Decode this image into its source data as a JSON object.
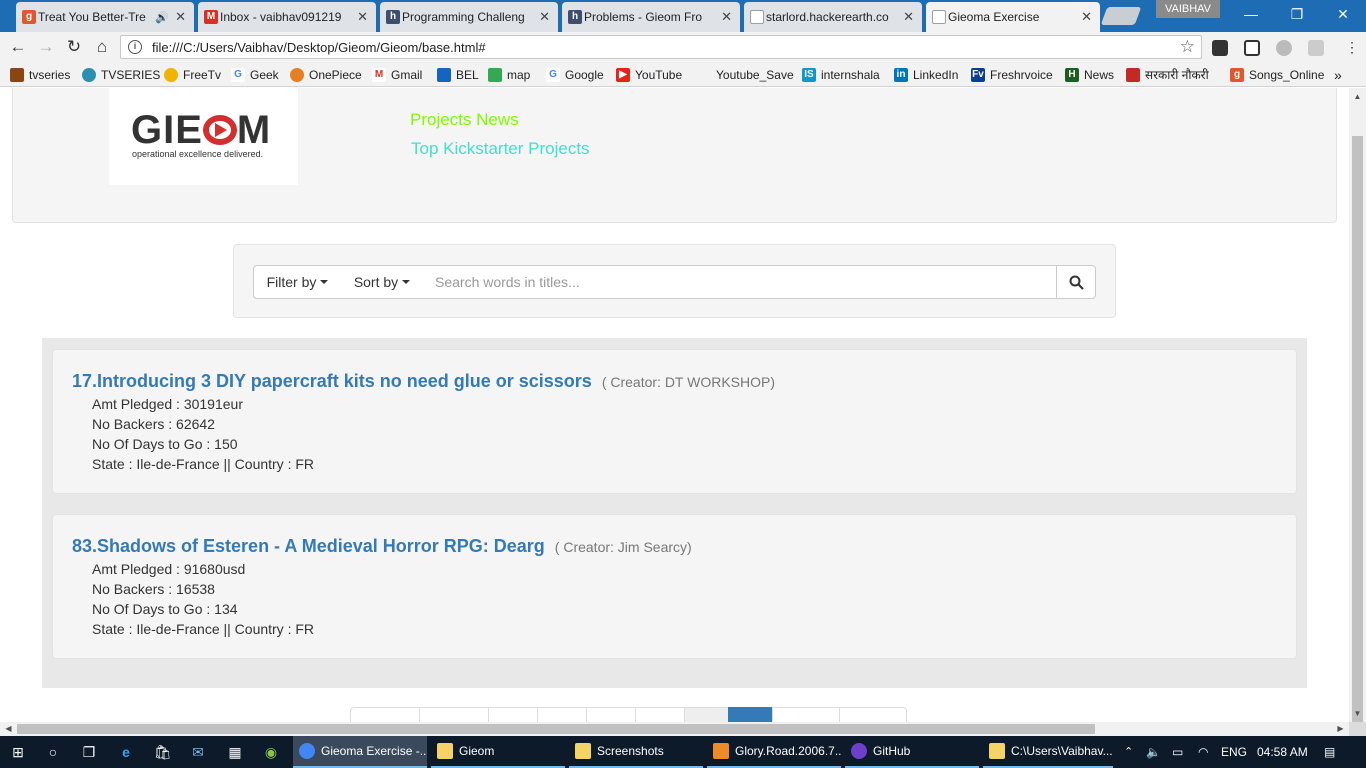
{
  "browser": {
    "tabs": [
      {
        "title": "Treat You Better-Tre",
        "favicon_color": "#e4572e",
        "favicon_glyph": "g",
        "audio": true
      },
      {
        "title": "Inbox - vaibhav091219",
        "favicon_color": "#d93025",
        "favicon_glyph": "M"
      },
      {
        "title": "Programming Challeng",
        "favicon_color": "#3d4e70",
        "favicon_glyph": "h"
      },
      {
        "title": "Problems - Gieom Fro",
        "favicon_color": "#3d4e70",
        "favicon_glyph": "h"
      },
      {
        "title": "starlord.hackerearth.co",
        "favicon_color": "#9aa0a6",
        "favicon_glyph": ""
      },
      {
        "title": "Gieoma Exercise",
        "favicon_color": "#9aa0a6",
        "favicon_glyph": "",
        "active": true
      }
    ],
    "profile_name": "VAIBHAV",
    "url": "file:///C:/Users/Vaibhav/Desktop/Gieom/Gieom/base.html#",
    "bookmarks": [
      {
        "label": "tvseries",
        "color": "#8b4513"
      },
      {
        "label": "TVSERIES",
        "color": "#2a8fb0"
      },
      {
        "label": "FreeTv",
        "color": "#f0b400"
      },
      {
        "label": "Geek",
        "color": "#4285f4"
      },
      {
        "label": "OnePiece",
        "color": "#e67e22"
      },
      {
        "label": "Gmail",
        "color": "#d93025"
      },
      {
        "label": "BEL",
        "color": "#1565c0"
      },
      {
        "label": "map",
        "color": "#34a853"
      },
      {
        "label": "Google",
        "color": "#4285f4"
      },
      {
        "label": "YouTube",
        "color": "#e62117"
      },
      {
        "label": "Youtube_Save",
        "color": ""
      },
      {
        "label": "internshala",
        "color": "#1295c9"
      },
      {
        "label": "LinkedIn",
        "color": "#0077b5"
      },
      {
        "label": "Freshrvoice",
        "color": "#0b3d91"
      },
      {
        "label": "News",
        "color": "#1b5e20"
      },
      {
        "label": "सरकारी नौकरी",
        "color": "#c62828"
      },
      {
        "label": "Songs_Online",
        "color": "#e4572e"
      }
    ],
    "bookmarks_overflow": "»"
  },
  "page": {
    "logo": {
      "wordmark_left": "GIE",
      "wordmark_right": "M",
      "tagline": "operational excellence delivered."
    },
    "nav": [
      {
        "label": "Projects News",
        "color": "#7cfc00"
      },
      {
        "label": "Top Kickstarter Projects",
        "color": "#40e0d0"
      }
    ],
    "search": {
      "filter_label": "Filter by",
      "sort_label": "Sort by",
      "placeholder": "Search words in titles..."
    },
    "projects": [
      {
        "title": "17.Introducing 3 DIY papercraft kits no need glue or scissors",
        "creator": "( Creator: DT WORKSHOP)",
        "amt": "Amt Pledged :   30191eur",
        "backers": "No Backers :   62642",
        "days": "No Of Days to Go :   150",
        "location": "State :   Ile-de-France    || Country :   FR"
      },
      {
        "title": "83.Shadows of Esteren - A Medieval Horror RPG: Dearg",
        "creator": "( Creator: Jim Searcy)",
        "amt": "Amt Pledged :   91680usd",
        "backers": "No Backers :   16538",
        "days": "No Of Days to Go :   134",
        "location": "State :   Ile-de-France    || Country :   FR"
      }
    ],
    "accent": "#337ab7"
  },
  "taskbar": {
    "items": [
      {
        "label": "Gieoma Exercise -...",
        "color": "#4285f4",
        "active": true
      },
      {
        "label": "Gieom",
        "color": "#f6d365"
      },
      {
        "label": "Screenshots",
        "color": "#f6d365"
      },
      {
        "label": "Glory.Road.2006.7...",
        "color": "#f08a24"
      },
      {
        "label": "GitHub",
        "color": "#6e40c9"
      },
      {
        "label": "C:\\Users\\Vaibhav...",
        "color": "#f6d365"
      }
    ],
    "language": "ENG",
    "time": "04:58 AM"
  }
}
